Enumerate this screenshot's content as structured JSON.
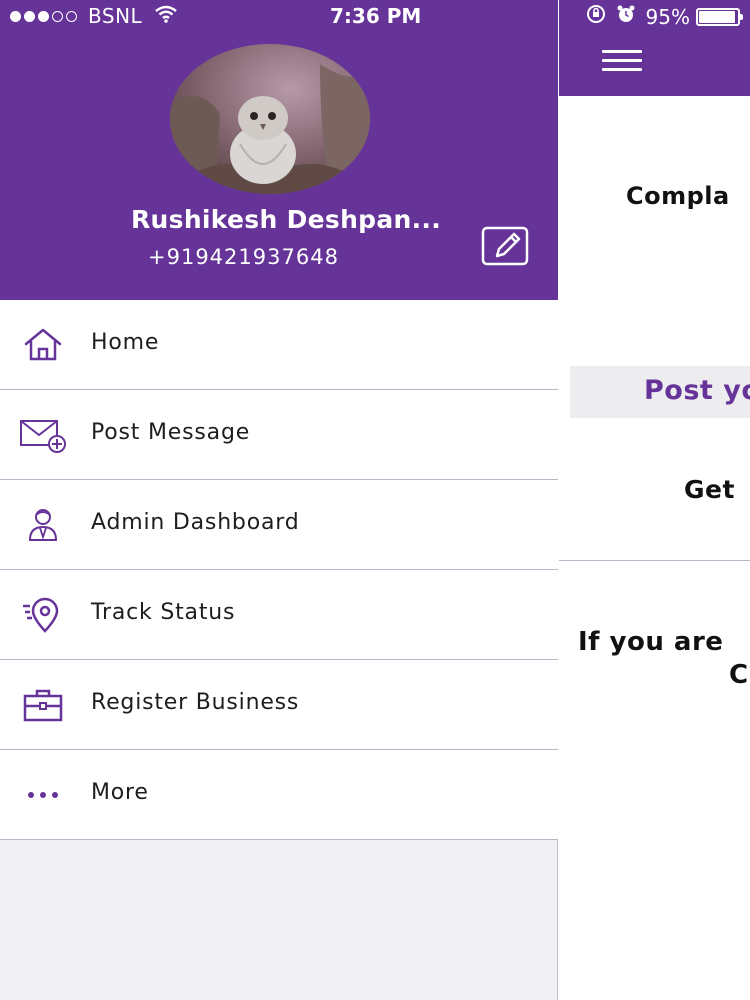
{
  "status_bar": {
    "carrier": "BSNL",
    "time": "7:36 PM",
    "battery": "95%",
    "battery_level": 0.95,
    "signal_bars_filled": 3,
    "signal_bars_total": 5,
    "icons": [
      "wifi-icon",
      "screen-rotation-lock-icon",
      "alarm-icon",
      "battery-icon"
    ]
  },
  "drawer": {
    "profile": {
      "name": "Rushikesh Deshpan...",
      "phone": "+919421937648",
      "edit_icon": "edit-icon"
    },
    "menu": [
      {
        "label": "Home",
        "icon": "home-icon"
      },
      {
        "label": "Post Message",
        "icon": "envelope-add-icon"
      },
      {
        "label": "Admin Dashboard",
        "icon": "admin-user-icon"
      },
      {
        "label": "Track Status",
        "icon": "location-pin-icon"
      },
      {
        "label": "Register Business",
        "icon": "briefcase-icon"
      },
      {
        "label": "More",
        "icon": "more-dots-icon"
      }
    ]
  },
  "main": {
    "menu_icon": "hamburger-menu-icon",
    "complaint_text": "Compla",
    "post_button_text": "Post yo",
    "get_text": "Get",
    "info_line1": "If you are",
    "info_line2": "C"
  },
  "colors": {
    "primary": "#663399",
    "menu_icon": "#663399",
    "background": "#efeff4",
    "text": "#1e1e1e"
  }
}
